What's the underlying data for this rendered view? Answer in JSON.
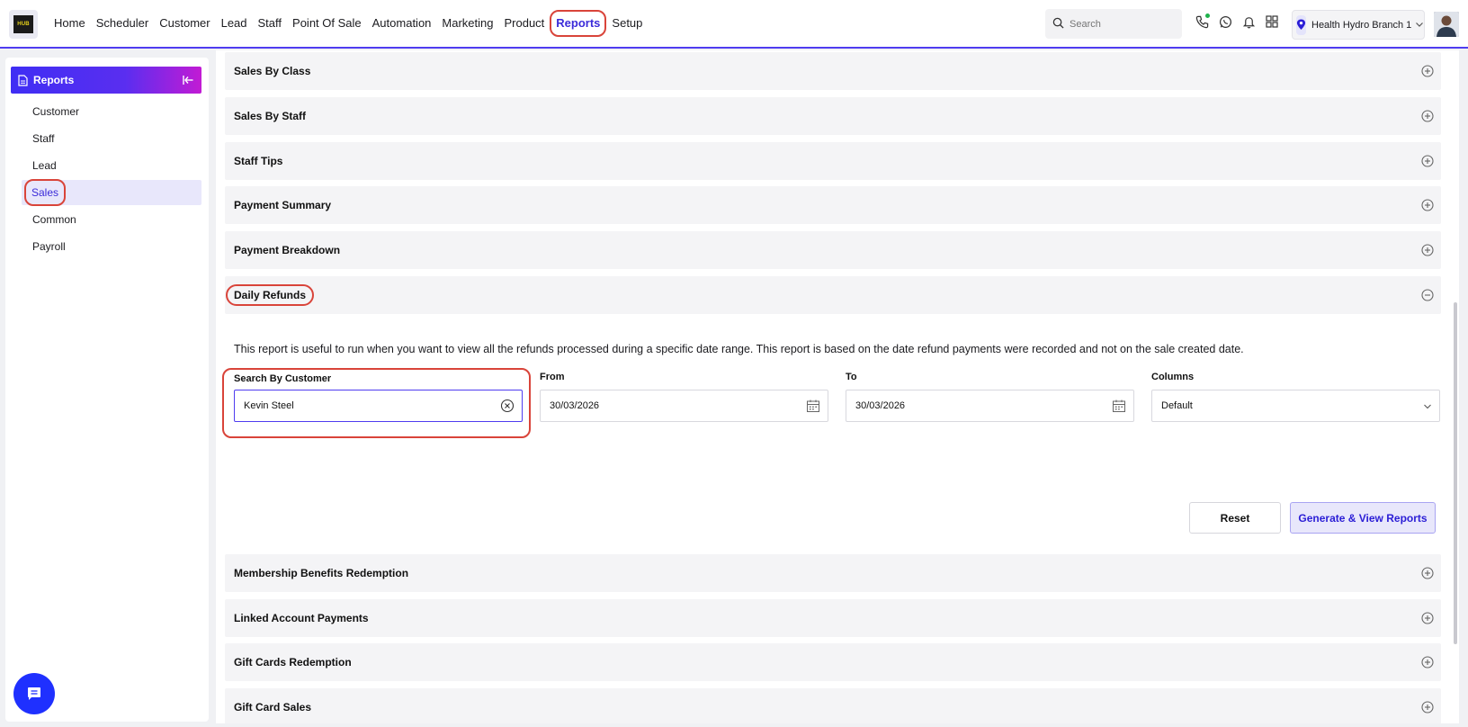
{
  "logo": {
    "text": "HUB"
  },
  "nav": {
    "items": [
      "Home",
      "Scheduler",
      "Customer",
      "Lead",
      "Staff",
      "Point Of Sale",
      "Automation",
      "Marketing",
      "Product",
      "Reports",
      "Setup"
    ],
    "active": "Reports"
  },
  "search": {
    "placeholder": "Search"
  },
  "top_icons": [
    "phone-icon",
    "whatsapp-icon",
    "bell-icon",
    "apps-grid-icon"
  ],
  "branch": {
    "label": "Health Hydro Branch 1"
  },
  "sidebar": {
    "title": "Reports",
    "items": [
      "Customer",
      "Staff",
      "Lead",
      "Sales",
      "Common",
      "Payroll"
    ],
    "active": "Sales"
  },
  "reports": {
    "collapsed_top": [
      "Sales By Class",
      "Sales By Staff",
      "Staff Tips",
      "Payment Summary",
      "Payment Breakdown"
    ],
    "expanded": {
      "title": "Daily Refunds",
      "description": "This report is useful to run when you want to view all the refunds processed during a specific date range. This report is based on the date refund payments were recorded and not on the sale created date.",
      "customer_label": "Search By Customer",
      "customer_value": "Kevin Steel",
      "from_label": "From",
      "from_value": "30/03/2026",
      "to_label": "To",
      "to_value": "30/03/2026",
      "columns_label": "Columns",
      "columns_value": "Default",
      "reset_label": "Reset",
      "generate_label": "Generate & View Reports"
    },
    "collapsed_bottom": [
      "Membership Benefits Redemption",
      "Linked Account Payments",
      "Gift Cards Redemption",
      "Gift Card Sales"
    ]
  },
  "colors": {
    "accent": "#4f3cf0",
    "highlight": "#d9443a",
    "brand_gradient_end": "#c21bd4"
  }
}
